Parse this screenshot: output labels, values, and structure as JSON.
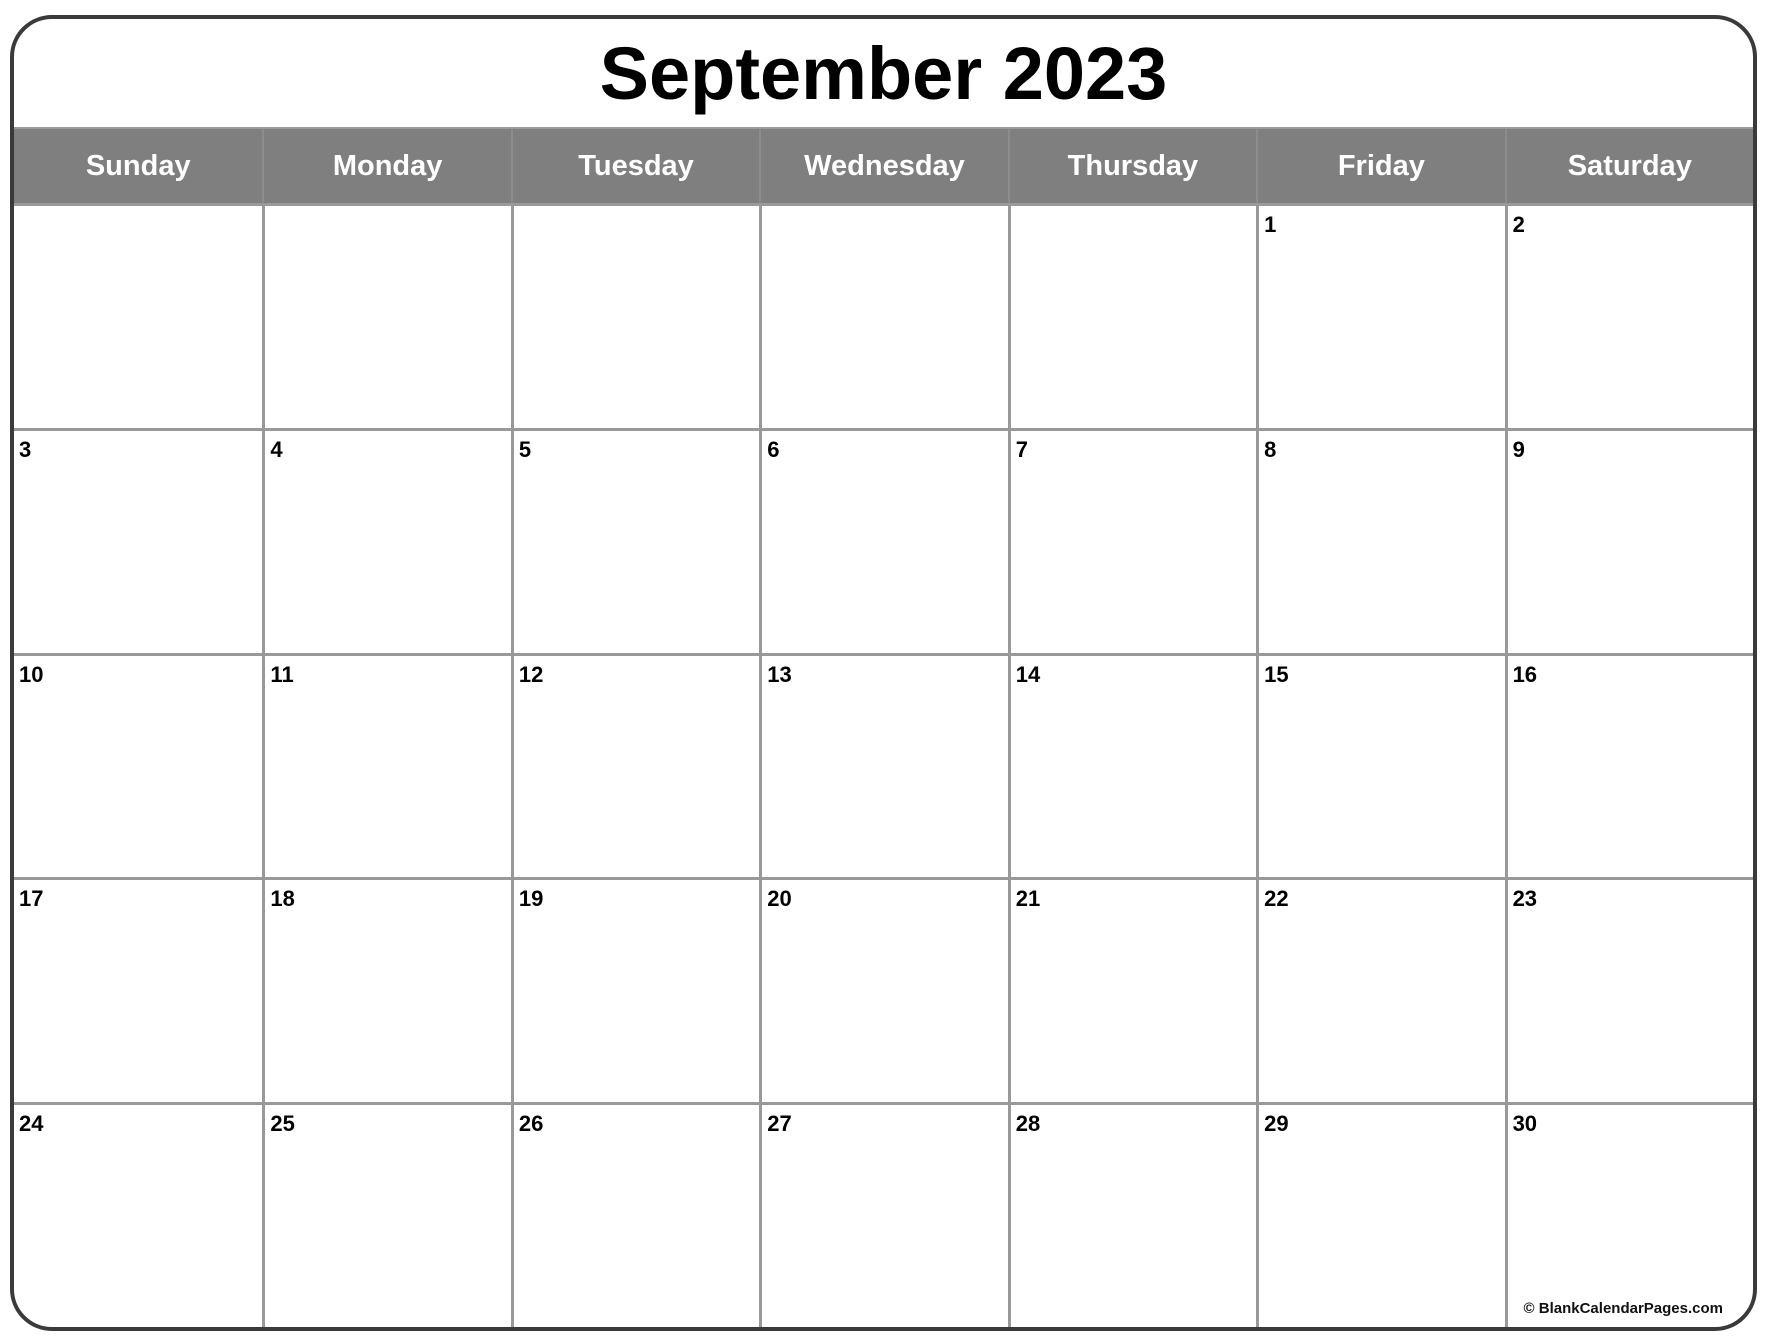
{
  "calendar": {
    "title": "September 2023",
    "month": "September",
    "year": 2023,
    "colors": {
      "header_band": "#7f7f7f",
      "header_text": "#ffffff",
      "grid_lines": "#999999",
      "outer_border": "#3a3a3a",
      "day_number": "#000000"
    },
    "weekdays": [
      "Sunday",
      "Monday",
      "Tuesday",
      "Wednesday",
      "Thursday",
      "Friday",
      "Saturday"
    ],
    "weeks": [
      [
        "",
        "",
        "",
        "",
        "",
        "1",
        "2"
      ],
      [
        "3",
        "4",
        "5",
        "6",
        "7",
        "8",
        "9"
      ],
      [
        "10",
        "11",
        "12",
        "13",
        "14",
        "15",
        "16"
      ],
      [
        "17",
        "18",
        "19",
        "20",
        "21",
        "22",
        "23"
      ],
      [
        "24",
        "25",
        "26",
        "27",
        "28",
        "29",
        "30"
      ]
    ],
    "footer": "© BlankCalendarPages.com"
  }
}
